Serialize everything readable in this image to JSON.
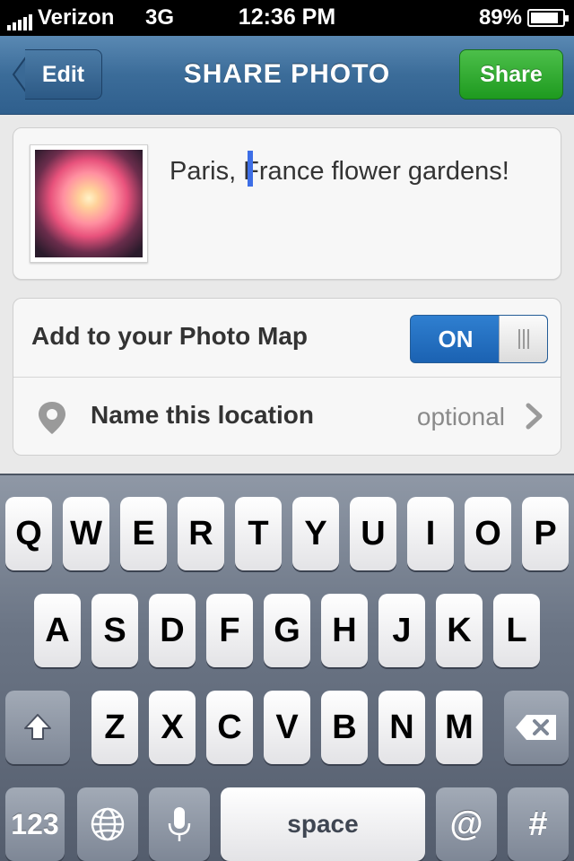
{
  "status": {
    "carrier": "Verizon",
    "network": "3G",
    "time": "12:36 PM",
    "battery": "89%"
  },
  "nav": {
    "title": "SHARE PHOTO",
    "back_label": "Edit",
    "share_label": "Share"
  },
  "caption": {
    "text": "Paris, France flower gardens!"
  },
  "photo_map": {
    "label": "Add to your Photo Map",
    "toggle": "ON"
  },
  "location": {
    "label": "Name this location",
    "placeholder": "optional"
  },
  "keyboard": {
    "row1": [
      "Q",
      "W",
      "E",
      "R",
      "T",
      "Y",
      "U",
      "I",
      "O",
      "P"
    ],
    "row2": [
      "A",
      "S",
      "D",
      "F",
      "G",
      "H",
      "J",
      "K",
      "L"
    ],
    "row3": [
      "Z",
      "X",
      "C",
      "V",
      "B",
      "N",
      "M"
    ],
    "numbers": "123",
    "space": "space",
    "at": "@",
    "hash": "#"
  },
  "colors": {
    "nav": "#3b6c99",
    "share": "#1e9a1f",
    "toggle": "#1b62b2",
    "cursor": "#3d6ee6"
  }
}
